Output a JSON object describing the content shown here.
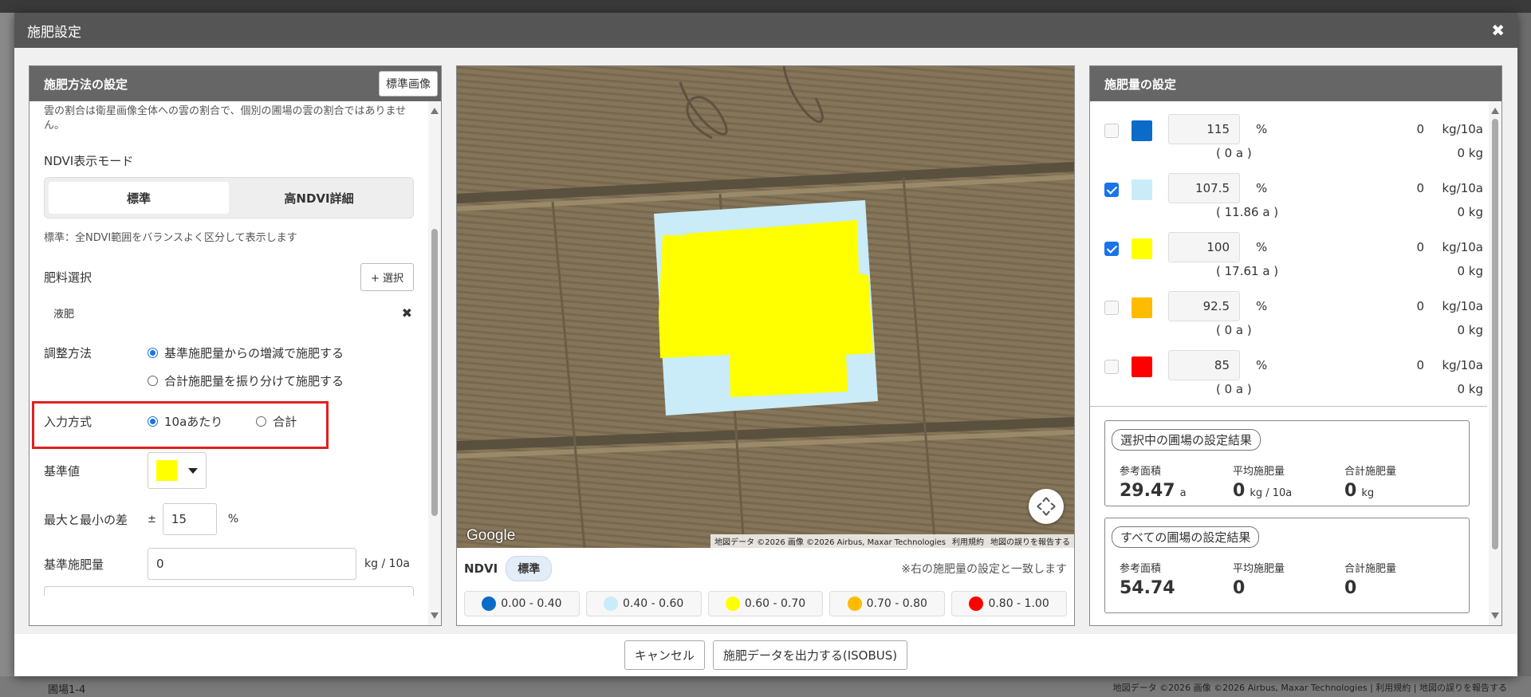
{
  "modal": {
    "title": "施肥設定",
    "close": "✖"
  },
  "left_panel": {
    "title": "施肥方法の設定",
    "std_image_button": "標準画像",
    "cloud_note": "雲の割合は衛星画像全体への雲の割合で、個別の圃場の雲の割合ではありません。",
    "ndvi_mode_label": "NDVI表示モード",
    "ndvi_modes": [
      "標準",
      "高NDVI詳細"
    ],
    "ndvi_mode_note": "標準：全NDVI範囲をバランスよく区分して表示します",
    "fertilizer_label": "肥料選択",
    "select_button": "+ 選択",
    "fertilizer_name": "液肥",
    "remove": "✖",
    "adjust_label": "調整方法",
    "adjust_options": [
      "基準施肥量からの増減で施肥する",
      "合計施肥量を振り分けて施肥する"
    ],
    "input_label": "入力方式",
    "input_options": [
      "10aあたり",
      "合計"
    ],
    "base_label": "基準値",
    "base_color": "#ffff00",
    "diff_label": "最大と最小の差",
    "diff_prefix": "±",
    "diff_value": "15",
    "diff_unit": "%",
    "base_rate_label": "基準施肥量",
    "base_rate_value": "0",
    "base_rate_unit": "kg / 10a"
  },
  "map_panel": {
    "google": "Google",
    "attribution": "地図データ ©2026 画像 ©2026 Airbus, Maxar Technologies",
    "terms": "利用規約",
    "report": "地図の誤りを報告する",
    "ndvi_label": "NDVI",
    "ndvi_mode": "標準",
    "match_note": "※右の施肥量の設定と一致します",
    "legend": [
      {
        "range": "0.00 - 0.40",
        "color": "#0a6cc8"
      },
      {
        "range": "0.40 - 0.60",
        "color": "#c9ecf8"
      },
      {
        "range": "0.60 - 0.70",
        "color": "#ffff00"
      },
      {
        "range": "0.70 - 0.80",
        "color": "#ffbb00"
      },
      {
        "range": "0.80 - 1.00",
        "color": "#ff0000"
      }
    ]
  },
  "right_panel": {
    "title": "施肥量の設定",
    "rows": [
      {
        "checked": false,
        "color": "#0a6cc8",
        "pct": "115",
        "pct_unit": "%",
        "area": "( 0 a )",
        "value": "0",
        "unit": "kg/10a",
        "kg": "0 kg"
      },
      {
        "checked": true,
        "color": "#c9ecf8",
        "pct": "107.5",
        "pct_unit": "%",
        "area": "( 11.86 a )",
        "value": "0",
        "unit": "kg/10a",
        "kg": "0 kg"
      },
      {
        "checked": true,
        "color": "#ffff00",
        "pct": "100",
        "pct_unit": "%",
        "area": "( 17.61 a )",
        "value": "0",
        "unit": "kg/10a",
        "kg": "0 kg"
      },
      {
        "checked": false,
        "color": "#ffbb00",
        "pct": "92.5",
        "pct_unit": "%",
        "area": "( 0 a )",
        "value": "0",
        "unit": "kg/10a",
        "kg": "0 kg"
      },
      {
        "checked": false,
        "color": "#ff0000",
        "pct": "85",
        "pct_unit": "%",
        "area": "( 0 a )",
        "value": "0",
        "unit": "kg/10a",
        "kg": "0 kg"
      }
    ],
    "selected_result": {
      "title": "選択中の圃場の設定結果",
      "area_label": "参考面積",
      "area_value": "29.47",
      "area_unit": "a",
      "avg_label": "平均施肥量",
      "avg_value": "0",
      "avg_unit": "kg / 10a",
      "total_label": "合計施肥量",
      "total_value": "0",
      "total_unit": "kg"
    },
    "all_result": {
      "title": "すべての圃場の設定結果",
      "area_label": "参考面積",
      "area_value": "54.74",
      "avg_label": "平均施肥量",
      "avg_value": "0",
      "total_label": "合計施肥量",
      "total_value": "0"
    }
  },
  "footer": {
    "cancel": "キャンセル",
    "export": "施肥データを出力する(ISOBUS)"
  },
  "background": {
    "field_label": "圃場1-4",
    "attribution": "地図データ ©2026 画像 ©2026 Airbus, Maxar Technologies | 利用規約 | 地図の誤りを報告する"
  }
}
